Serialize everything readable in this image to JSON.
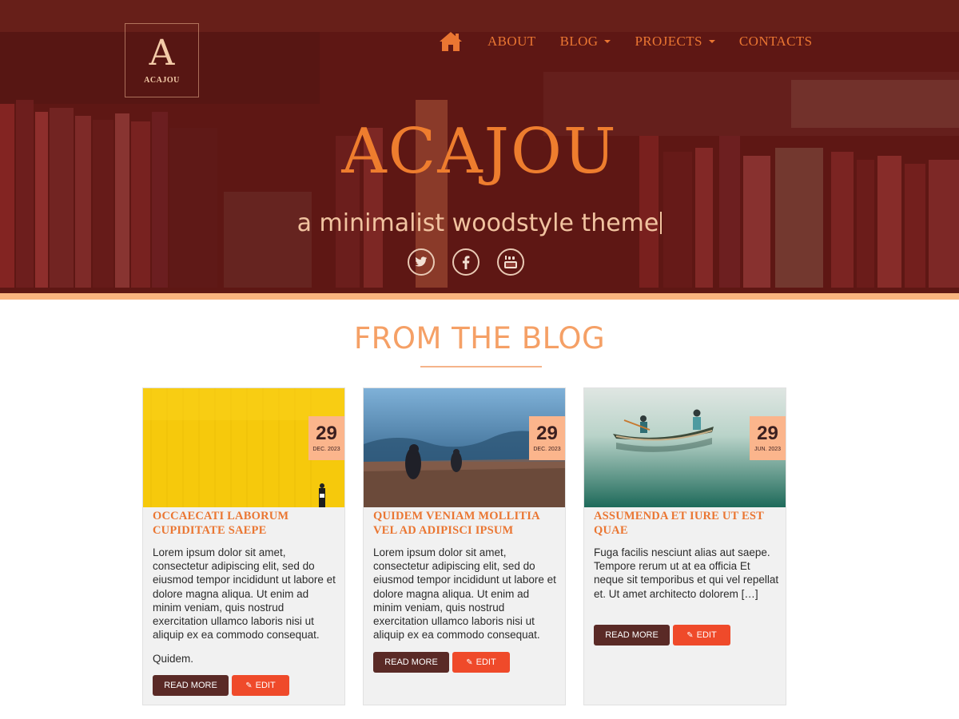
{
  "header": {
    "logo_letter": "A",
    "logo_text": "ACAJOU",
    "nav": [
      {
        "label": "ABOUT",
        "dropdown": false
      },
      {
        "label": "BLOG",
        "dropdown": true
      },
      {
        "label": "PROJECTS",
        "dropdown": true
      },
      {
        "label": "CONTACTS",
        "dropdown": false
      }
    ],
    "home_icon": "home-icon"
  },
  "hero": {
    "title": "ACAJOU",
    "subtitle": "a minimalist woodstyle theme",
    "socials": [
      "twitter-icon",
      "facebook-icon",
      "youtube-icon"
    ]
  },
  "blog": {
    "title": "FROM THE BLOG",
    "posts": [
      {
        "day": "29",
        "month": "DEC. 2023",
        "title": "OCCAECATI LABORUM CUPIDITATE SAEPE",
        "excerpt": "Lorem ipsum dolor sit amet, consectetur adipiscing elit, sed do eiusmod tempor incididunt ut labore et dolore magna aliqua. Ut enim ad minim veniam, quis nostrud exercitation ullamco laboris nisi ut aliquip ex ea commodo consequat.",
        "extra": "Quidem.",
        "read_more": "READ MORE",
        "edit": "EDIT"
      },
      {
        "day": "29",
        "month": "DEC. 2023",
        "title": "QUIDEM VENIAM MOLLITIA VEL AD ADIPISCI IPSUM",
        "excerpt": "Lorem ipsum dolor sit amet, consectetur adipiscing elit, sed do eiusmod tempor incididunt ut labore et dolore magna aliqua. Ut enim ad minim veniam, quis nostrud exercitation ullamco laboris nisi ut aliquip ex ea commodo consequat.",
        "read_more": "READ MORE",
        "edit": "EDIT"
      },
      {
        "day": "29",
        "month": "JUN. 2023",
        "title": "ASSUMENDA ET IURE UT EST QUAE",
        "excerpt": "Fuga facilis nesciunt alias aut saepe. Tempore rerum ut at ea officia Et neque sit temporibus et qui vel repellat et. Ut amet architecto dolorem […]",
        "read_more": "READ MORE",
        "edit": "EDIT"
      }
    ]
  },
  "colors": {
    "accent": "#ea7632",
    "hero_overlay": "#621612",
    "badge": "#fbb58c",
    "read_more_btn": "#5a2a26",
    "edit_btn": "#ef4a2a"
  }
}
